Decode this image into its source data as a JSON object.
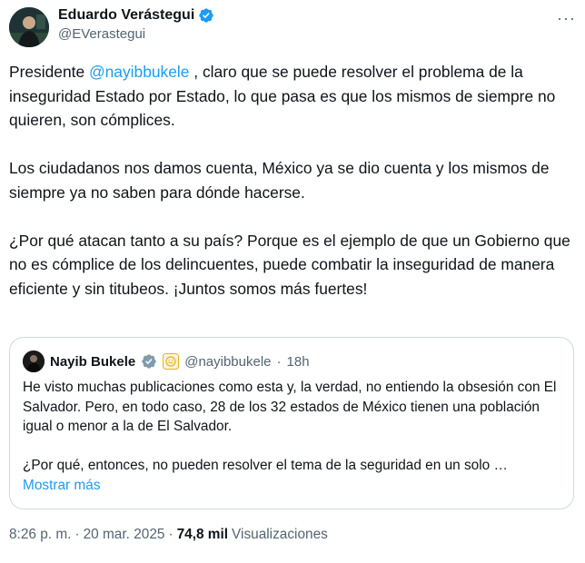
{
  "author": {
    "display_name": "Eduardo Verástegui",
    "handle": "@EVerastegui"
  },
  "more_label": "···",
  "tweet": {
    "prefix": "Presidente ",
    "mention": "@nayibbukele",
    "rest": " , claro que se puede resolver el problema de la inseguridad Estado por Estado, lo que pasa es que los mismos de siempre no quieren, son cómplices.\n\nLos ciudadanos nos damos cuenta, México ya se dio cuenta y los mismos de siempre ya no saben para dónde hacerse.\n\n¿Por qué atacan tanto a su país? Porque es el ejemplo de que un Gobierno que no es cómplice de los delincuentes, puede combatir la inseguridad de manera eficiente y sin titubeos. ¡Juntos somos más fuertes!"
  },
  "quote": {
    "display_name": "Nayib Bukele",
    "handle": "@nayibbukele",
    "separator": "·",
    "time": "18h",
    "text": "He visto muchas publicaciones como esta y, la verdad, no entiendo la obsesión con El Salvador. Pero, en todo caso, 28 de los 32 estados de México tienen una población igual o menor a la de El Salvador.\n\n¿Por qué, entonces, no pueden resolver el tema de la seguridad en un solo …",
    "show_more": "Mostrar más"
  },
  "footer": {
    "time": "8:26 p. m.",
    "sep1": "·",
    "date": "20 mar. 2025",
    "sep2": "·",
    "views_count": "74,8 mil",
    "views_label": "Visualizaciones"
  },
  "icons": {
    "verified": "verified-badge-icon",
    "affiliate": "affiliate-badge-icon",
    "verified_color": "#1d9bf0",
    "gray_check_color": "#829aab",
    "gold_color": "#e2b719"
  }
}
